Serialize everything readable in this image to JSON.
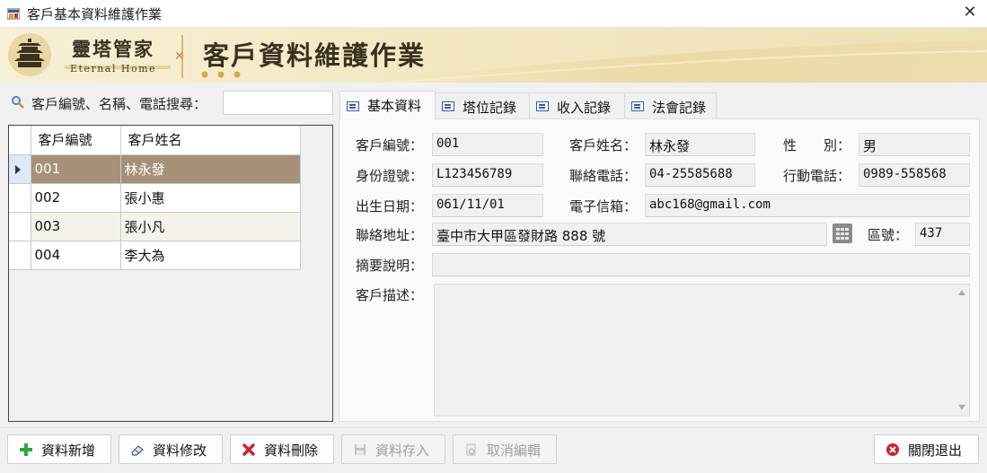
{
  "window": {
    "title": "客戶基本資料維護作業"
  },
  "banner": {
    "brand": "靈塔管家",
    "brand_en": "Eternal Home",
    "heading": "客戶資料維護作業"
  },
  "search": {
    "label": "客戶編號、名稱、電話搜尋：",
    "value": ""
  },
  "grid": {
    "columns": [
      "客戶編號",
      "客戶姓名"
    ],
    "rows": [
      {
        "id": "001",
        "name": "林永發"
      },
      {
        "id": "002",
        "name": "張小惠"
      },
      {
        "id": "003",
        "name": "張小凡"
      },
      {
        "id": "004",
        "name": "李大為"
      }
    ],
    "selected_index": 0
  },
  "tabs": [
    {
      "label": "基本資料",
      "active": true
    },
    {
      "label": "塔位記錄",
      "active": false
    },
    {
      "label": "收入記錄",
      "active": false
    },
    {
      "label": "法會記錄",
      "active": false
    }
  ],
  "form": {
    "customer_id": {
      "label": "客戶編號：",
      "value": "001"
    },
    "customer_name": {
      "label": "客戶姓名：",
      "value": "林永發"
    },
    "gender": {
      "label": "性　　別：",
      "value": "男"
    },
    "id_number": {
      "label": "身份證號：",
      "value": "L123456789"
    },
    "phone": {
      "label": "聯絡電話：",
      "value": "04-25585688"
    },
    "mobile": {
      "label": "行動電話：",
      "value": "0989-558568"
    },
    "birth_date": {
      "label": "出生日期：",
      "value": "061/11/01"
    },
    "email": {
      "label": "電子信箱：",
      "value": "abc168@gmail.com"
    },
    "address": {
      "label": "聯絡地址：",
      "value": "臺中市大甲區發財路 888 號"
    },
    "zip": {
      "label": "區號：",
      "value": "437"
    },
    "summary": {
      "label": "摘要說明：",
      "value": ""
    },
    "description": {
      "label": "客戶描述：",
      "value": ""
    }
  },
  "buttons": {
    "add": "資料新增",
    "edit": "資料修改",
    "delete": "資料刪除",
    "save": "資料存入",
    "cancel": "取消編輯",
    "close": "關閉退出"
  },
  "colors": {
    "selected_row": "#a69178",
    "banner": "#f4e8c4",
    "accent_red": "#d0202a",
    "accent_green": "#2fa83a"
  }
}
